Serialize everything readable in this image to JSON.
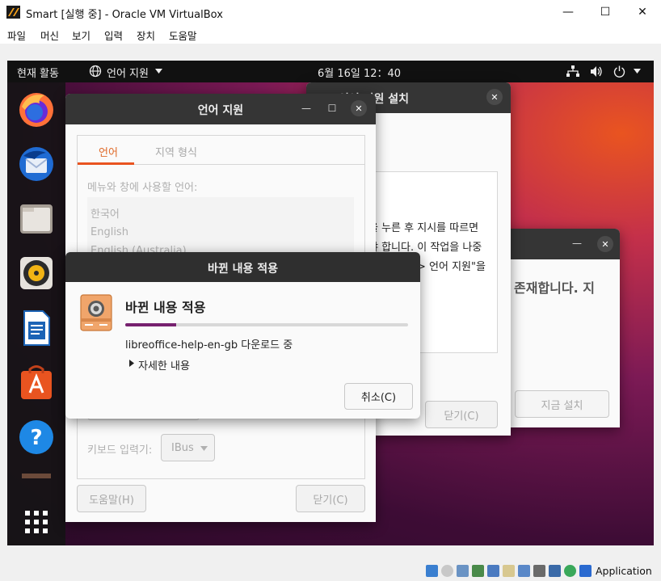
{
  "host": {
    "title": "Smart [실행 중] - Oracle VM VirtualBox",
    "controls": {
      "minimize": "—",
      "maximize": "☐",
      "close": "✕"
    },
    "menu": [
      "파일",
      "머신",
      "보기",
      "입력",
      "장치",
      "도움말"
    ],
    "status_label": "Application"
  },
  "topbar": {
    "activities": "현재 활동",
    "app_menu": "언어 지원",
    "clock": "6월 16일  12：40"
  },
  "lang_window": {
    "title": "언어 지원",
    "tabs": [
      "언어",
      "지역 형식"
    ],
    "list_label": "메뉴와 창에 사용할 언어:",
    "languages": [
      "한국어",
      "English",
      "English (Australia)"
    ],
    "keyboard_label": "키보드 입력기:",
    "keyboard_value": "IBus",
    "help_button": "도움말(H)",
    "close_button": "닫기(C)"
  },
  "back_window": {
    "title_partial": "언어 지원 설치",
    "text_lines": [
      "을 누른 후 지시를 따르면",
      "야 합니다. 이 작업을 나중",
      "> 언어 지원\"을"
    ],
    "close_button": "닫기(C)"
  },
  "right_window": {
    "text": "존재합니다. 지",
    "install_button": "지금 설치"
  },
  "apply_dialog": {
    "title": "바뀐 내용 적용",
    "heading": "바뀐 내용 적용",
    "progress": 0.18,
    "status": "libreoffice-help-en-gb 다운로드 중",
    "details": "자세한 내용",
    "cancel": "취소(C)"
  },
  "colors": {
    "accent": "#77216f",
    "orange": "#e95420",
    "header_dark": "#353535"
  }
}
